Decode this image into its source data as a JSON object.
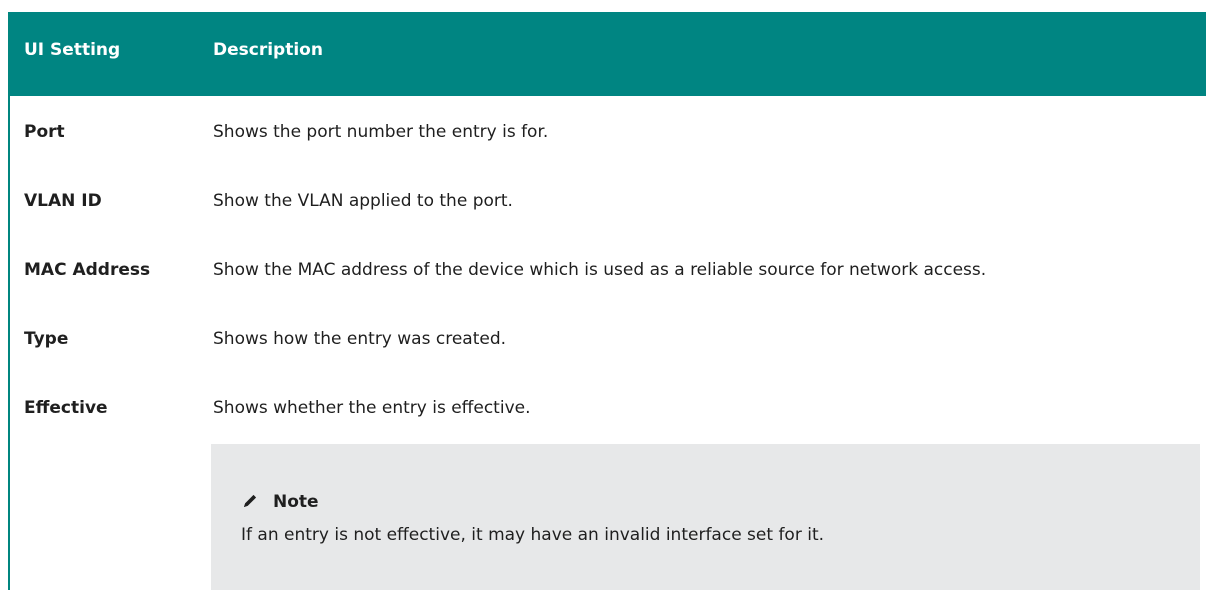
{
  "table": {
    "headers": {
      "setting": "UI Setting",
      "description": "Description"
    },
    "rows": [
      {
        "setting": "Port",
        "description": "Shows the port number the entry is for."
      },
      {
        "setting": "VLAN ID",
        "description": "Show the VLAN applied to the port."
      },
      {
        "setting": "MAC Address",
        "description": "Show the MAC address of the device which is used as a reliable source for network access."
      },
      {
        "setting": "Type",
        "description": "Shows how the entry was created."
      },
      {
        "setting": "Effective",
        "description": "Shows whether the entry is effective."
      }
    ]
  },
  "note": {
    "icon": "pencil-icon",
    "title": "Note",
    "text": "If an entry is not effective, it may have an invalid interface set for it."
  },
  "colors": {
    "header_bg": "#008582",
    "note_bg": "#e7e8e9"
  }
}
